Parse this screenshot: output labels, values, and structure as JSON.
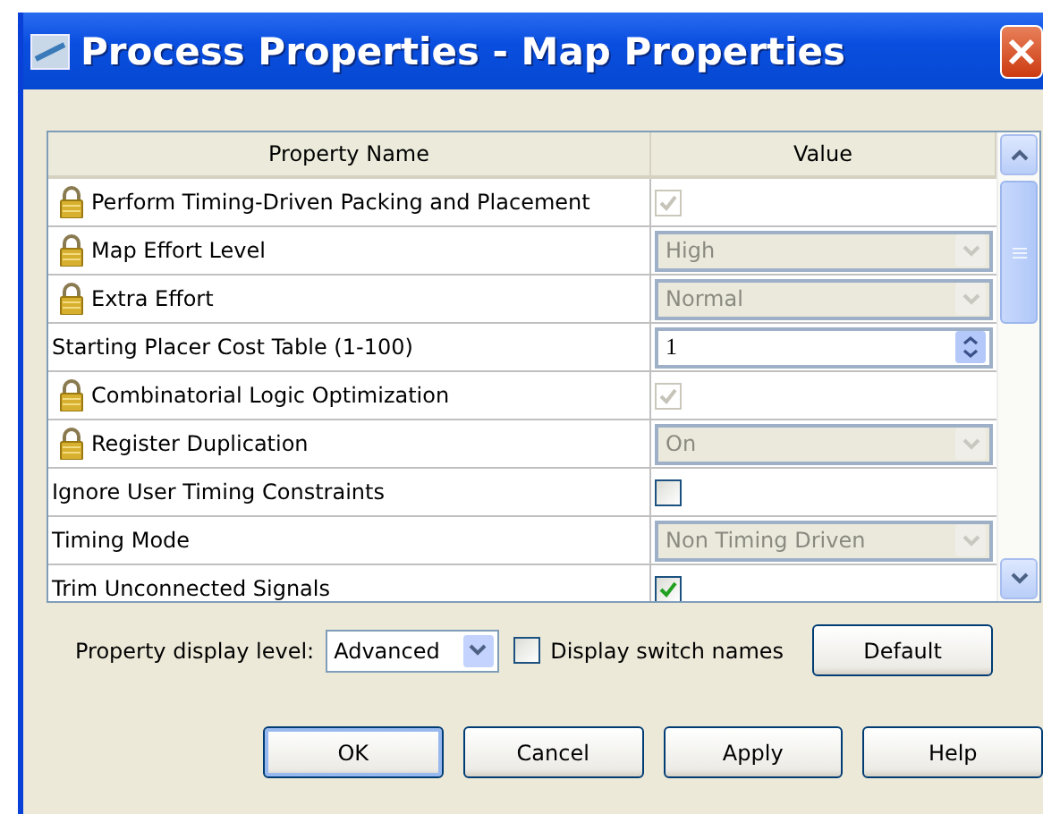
{
  "window": {
    "title": "Process Properties - Map Properties"
  },
  "table": {
    "columns": [
      "Property Name",
      "Value"
    ],
    "rows": [
      {
        "name": "Perform Timing-Driven Packing and Placement",
        "locked": true,
        "kind": "checkbox",
        "checked": true,
        "disabled": true
      },
      {
        "name": "Map Effort Level",
        "locked": true,
        "kind": "select",
        "value": "High",
        "disabled": true
      },
      {
        "name": "Extra Effort",
        "locked": true,
        "kind": "select",
        "value": "Normal",
        "disabled": true
      },
      {
        "name": "Starting Placer Cost Table (1-100)",
        "locked": false,
        "kind": "spin",
        "value": "1",
        "disabled": false
      },
      {
        "name": "Combinatorial Logic Optimization",
        "locked": true,
        "kind": "checkbox",
        "checked": true,
        "disabled": true
      },
      {
        "name": "Register Duplication",
        "locked": true,
        "kind": "select",
        "value": "On",
        "disabled": true
      },
      {
        "name": "Ignore User Timing Constraints",
        "locked": false,
        "kind": "checkbox",
        "checked": false,
        "disabled": false
      },
      {
        "name": "Timing Mode",
        "locked": false,
        "kind": "select",
        "value": "Non Timing Driven",
        "disabled": true
      },
      {
        "name": "Trim Unconnected Signals",
        "locked": false,
        "kind": "checkbox",
        "checked": true,
        "disabled": false
      }
    ]
  },
  "display_level": {
    "label": "Property display level:",
    "value": "Advanced"
  },
  "switch_names": {
    "label": "Display switch names",
    "checked": false
  },
  "default_button": "Default",
  "buttons": [
    {
      "label": "OK",
      "selected": true
    },
    {
      "label": "Cancel",
      "selected": false
    },
    {
      "label": "Apply",
      "selected": false
    },
    {
      "label": "Help",
      "selected": false
    }
  ]
}
